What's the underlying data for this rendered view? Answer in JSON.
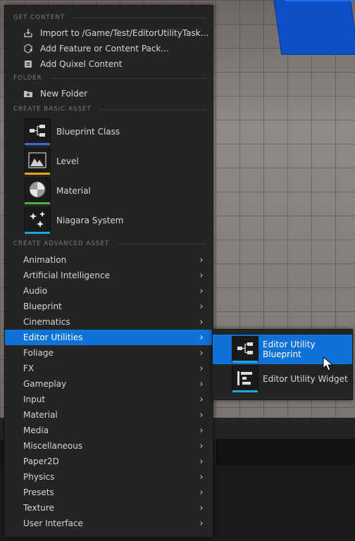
{
  "sections": {
    "get_content": "GET CONTENT",
    "folder": "FOLDER",
    "create_basic_asset": "CREATE BASIC ASSET",
    "create_advanced_asset": "CREATE ADVANCED ASSET"
  },
  "get_content_items": [
    {
      "label": "Import to /Game/Test/EditorUtilityTask...",
      "icon": "import-icon"
    },
    {
      "label": "Add Feature or Content Pack...",
      "icon": "feature-pack-icon"
    },
    {
      "label": "Add Quixel Content",
      "icon": "quixel-icon"
    }
  ],
  "folder_items": [
    {
      "label": "New Folder",
      "icon": "new-folder-icon"
    }
  ],
  "basic_assets": [
    {
      "label": "Blueprint Class",
      "icon": "blueprint-icon",
      "color": "#3a6bdc"
    },
    {
      "label": "Level",
      "icon": "level-icon",
      "color": "#e8a21a"
    },
    {
      "label": "Material",
      "icon": "material-icon",
      "color": "#3fb43f"
    },
    {
      "label": "Niagara System",
      "icon": "niagara-icon",
      "color": "#1aa6e0"
    }
  ],
  "advanced_assets": [
    {
      "label": "Animation"
    },
    {
      "label": "Artificial Intelligence"
    },
    {
      "label": "Audio"
    },
    {
      "label": "Blueprint"
    },
    {
      "label": "Cinematics"
    },
    {
      "label": "Editor Utilities",
      "selected": true
    },
    {
      "label": "Foliage"
    },
    {
      "label": "FX"
    },
    {
      "label": "Gameplay"
    },
    {
      "label": "Input"
    },
    {
      "label": "Material"
    },
    {
      "label": "Media"
    },
    {
      "label": "Miscellaneous"
    },
    {
      "label": "Paper2D"
    },
    {
      "label": "Physics"
    },
    {
      "label": "Presets"
    },
    {
      "label": "Texture"
    },
    {
      "label": "User Interface"
    }
  ],
  "submenu": [
    {
      "label": "Editor Utility Blueprint",
      "icon": "editor-utility-blueprint-icon",
      "color": "#1aa6e0",
      "hover": true
    },
    {
      "label": "Editor Utility Widget",
      "icon": "editor-utility-widget-icon",
      "color": "#1aa6e0"
    }
  ],
  "colors": {
    "selection": "#0f72d6",
    "menu_bg": "#242424",
    "cube": "#0e50c8"
  }
}
